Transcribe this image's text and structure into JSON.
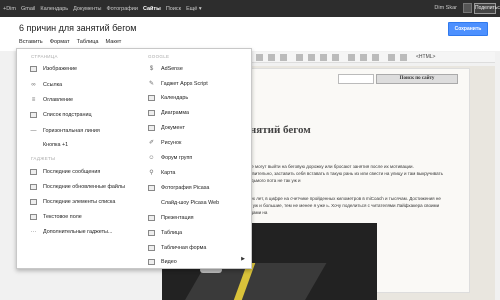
{
  "gbar": {
    "items": [
      "+Dim",
      "Gmail",
      "Календарь",
      "Документы",
      "Фотографии",
      "Сайты",
      "Поиск",
      "Ещё ▾"
    ],
    "active_index": 5,
    "user": "Dim Skar",
    "share_label": "Поделиться"
  },
  "doc": {
    "title": "6 причин для занятий бегом",
    "menu": [
      "Вставить",
      "Формат",
      "Таблица",
      "Макет"
    ],
    "save_label": "Сохранить"
  },
  "toolbar": {
    "html_label": "<HTML>"
  },
  "dropdown": {
    "left_section_top": "СТРАНИЦА",
    "left_items_1": [
      {
        "label": "Изображение",
        "icon": "image-icon"
      },
      {
        "label": "Ссылка",
        "icon": "link-icon"
      },
      {
        "label": "Оглавление",
        "icon": "toc-icon"
      },
      {
        "label": "Список подстраниц",
        "icon": "subpages-icon"
      },
      {
        "label": "Горизонтальная линия",
        "icon": "hr-icon"
      },
      {
        "label": "Кнопка +1",
        "icon": ""
      }
    ],
    "left_section_gadgets": "ГАДЖЕТЫ",
    "left_items_2": [
      {
        "label": "Последние сообщения",
        "icon": "messages-icon"
      },
      {
        "label": "Последние обновленные файлы",
        "icon": "files-icon"
      },
      {
        "label": "Последние элементы списка",
        "icon": "list-icon"
      },
      {
        "label": "Текстовое поле",
        "icon": "textbox-icon"
      },
      {
        "label": "Дополнительные гаджеты...",
        "icon": "more-icon"
      }
    ],
    "right_section_top": "GOOGLE",
    "right_items": [
      {
        "label": "AdSense",
        "icon": "adsense-icon"
      },
      {
        "label": "Гаджет Apps Script",
        "icon": "script-icon"
      },
      {
        "label": "Календарь",
        "icon": "calendar-icon"
      },
      {
        "label": "Диаграмма",
        "icon": "chart-icon"
      },
      {
        "label": "Документ",
        "icon": "document-icon"
      },
      {
        "label": "Рисунок",
        "icon": "drawing-icon"
      },
      {
        "label": "Форум групп",
        "icon": "groups-icon"
      },
      {
        "label": "Карта",
        "icon": "map-icon"
      },
      {
        "label": "Фотография Picasa",
        "icon": "picasa-icon"
      },
      {
        "label": "Слайд-шоу Picasa Web",
        "icon": ""
      },
      {
        "label": "Презентация",
        "icon": "presentation-icon"
      },
      {
        "label": "Таблица",
        "icon": "table-icon"
      },
      {
        "label": "Табличная форма",
        "icon": "form-icon"
      },
      {
        "label": "Видео",
        "icon": "video-icon"
      }
    ],
    "video_arrow": "▶"
  },
  "page": {
    "search_button": "Поиск по сайту",
    "post_title": "занятий бегом",
    "para1": "оди не могут выйти на беговую дорожку или бросают занятия после их мотивации. Действительно, заставить себя вставать в такую рань из или свести на улицу и там выкручивать до седьмого пота не так уж и",
    "para2": "то трех лет, в цифре на счетчике пройденных километров в miCoach и тысячам. Достижения не такие уж и большие, тем не менее я уже ь. Хочу поделиться с читателями Лайфхакера своими выводами на"
  },
  "colors": {
    "accent": "#4d90fe",
    "gbar_bg": "#2d2d2d"
  }
}
